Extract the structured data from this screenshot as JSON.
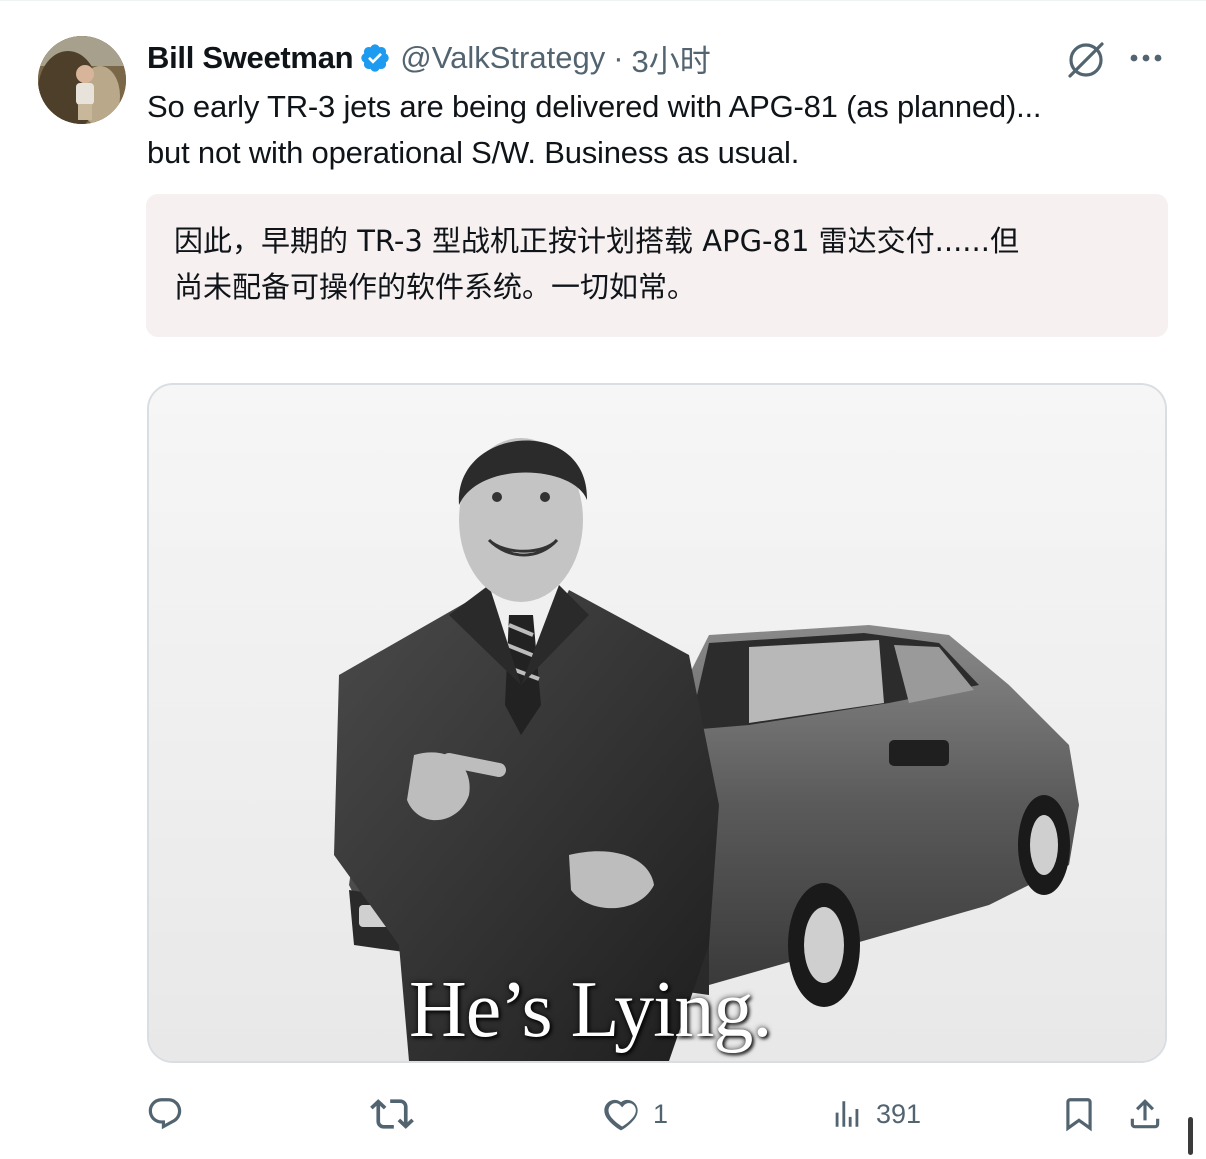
{
  "tweet": {
    "author_name": "Bill Sweetman",
    "handle": "@ValkStrategy",
    "separator": "·",
    "time": "3小时",
    "text_line1": "So early TR-3 jets are being delivered with APG-81 (as planned)...",
    "text_line2": "but not with operational S/W. Business as usual.",
    "translation_line1": "因此，早期的 TR-3 型战机正按计划搭载 APG-81 雷达交付......但",
    "translation_line2": "尚未配备可操作的软件系统。一切如常。",
    "media_caption": "He’s Lying."
  },
  "actions": {
    "like_count": "1",
    "view_count": "391"
  },
  "icons": {
    "verified": "verified-badge-icon",
    "grok": "grok-icon",
    "more": "more-icon",
    "reply": "reply-icon",
    "retweet": "retweet-icon",
    "like": "heart-icon",
    "views": "views-icon",
    "bookmark": "bookmark-icon",
    "share": "share-icon"
  },
  "colors": {
    "verified": "#1d9bf0",
    "secondary_text": "#536471",
    "translation_bg": "#f7f0f0"
  }
}
